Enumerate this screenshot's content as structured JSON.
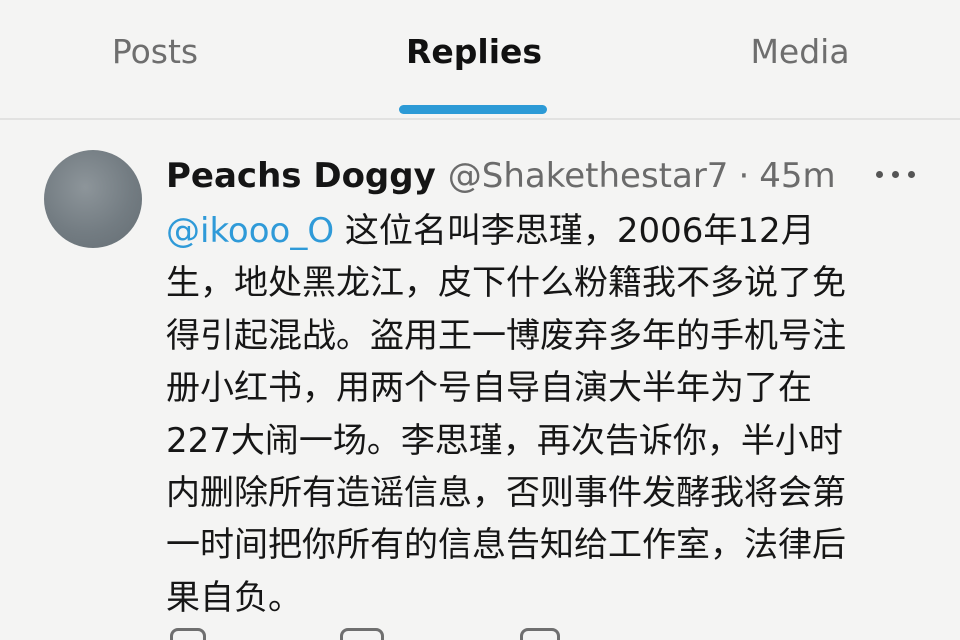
{
  "tabs": {
    "posts": "Posts",
    "replies": "Replies",
    "media": "Media",
    "active": "Replies"
  },
  "colors": {
    "accent": "#2c9ad6",
    "mention": "#2f9ad8",
    "muted_text": "#6b6b6b",
    "background": "#f4f4f3"
  },
  "tweet": {
    "display_name": "Peachs Doggy",
    "handle": "@Shakethestar7",
    "separator": "·",
    "time": "45m",
    "more_icon": "more-horizontal-icon",
    "mention": "@ikooo_O",
    "lines": [
      " 这位名叫李思瑾，2006年12月",
      "生，地处黑龙江，皮下什么粉籍我不多说了免",
      "得引起混战。盗用王一博废弃多年的手机号注",
      "册小红书，用两个号自导自演大半年为了在",
      "227大闹一场。李思瑾，再次告诉你，半小时",
      "内删除所有造谣信息，否则事件发酵我将会第",
      "一时间把你所有的信息告知给工作室，法律后",
      "果自负。"
    ],
    "actions": [
      "reply-icon",
      "retweet-icon",
      "like-icon"
    ]
  }
}
